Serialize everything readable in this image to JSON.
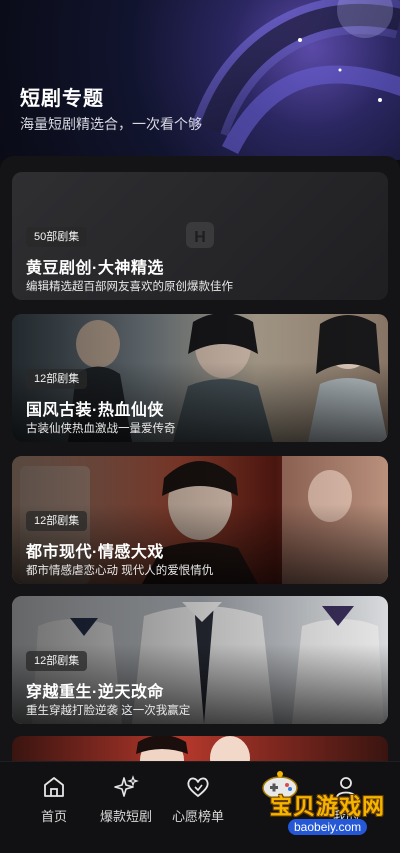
{
  "header": {
    "title": "短剧专题",
    "subtitle": "海量短剧精选合，一次看个够"
  },
  "cards": [
    {
      "badge": "50部剧集",
      "title": "黄豆剧创·大神精选",
      "desc": "编辑精选超百部网友喜欢的原创爆款佳作",
      "bg_color": "#2a2a2c"
    },
    {
      "badge": "12部剧集",
      "title": "国风古装·热血仙侠",
      "desc": "古装仙侠热血激战一量爱传奇",
      "bg_color": "#6b7f8c"
    },
    {
      "badge": "12部剧集",
      "title": "都市现代·情感大戏",
      "desc": "都市情感虐恋心动 现代人的爱恨情仇",
      "bg_color": "#8a3a2c"
    },
    {
      "badge": "12部剧集",
      "title": "穿越重生·逆天改命",
      "desc": "重生穿越打脸逆袭 这一次我赢定",
      "bg_color": "#b9bfc6"
    }
  ],
  "tabbar": {
    "items": [
      {
        "label": "首页",
        "icon": "home-icon"
      },
      {
        "label": "爆款短剧",
        "icon": "sparkle-icon"
      },
      {
        "label": "心愿榜单",
        "icon": "heart-icon"
      },
      {
        "label": "",
        "icon": "gamepad-icon"
      },
      {
        "label": "我的",
        "icon": "profile-icon"
      }
    ]
  },
  "watermark": {
    "title": "宝贝游戏网",
    "url": "baobeiy.com"
  }
}
